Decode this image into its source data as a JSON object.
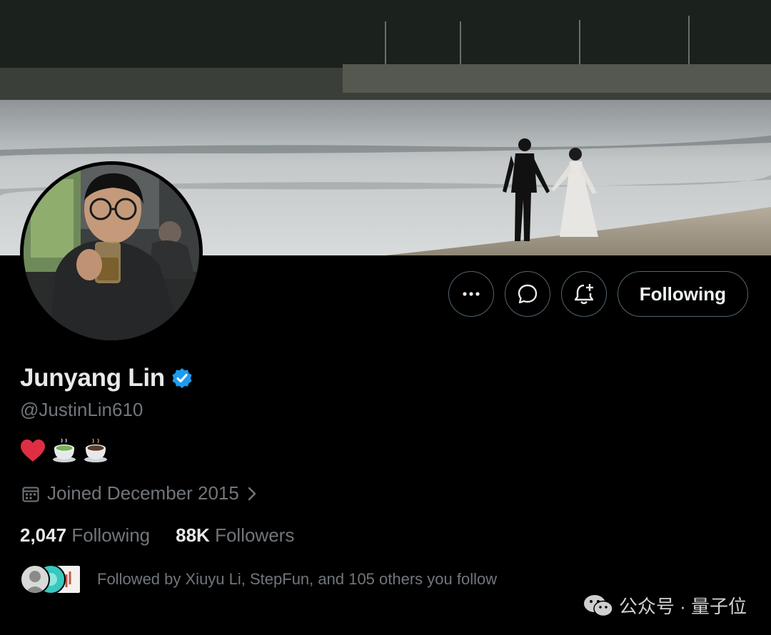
{
  "profile": {
    "display_name": "Junyang Lin",
    "handle": "@JustinLin610",
    "verified": true,
    "verified_color": "#1d9bf0",
    "bio_emojis": [
      "red-heart",
      "matcha-tea-cup",
      "coffee-cup"
    ],
    "joined": "Joined December 2015",
    "following_count": "2,047",
    "following_label": "Following",
    "followers_count": "88K",
    "followers_label": "Followers",
    "followed_by": "Followed by Xiuyu Li, StepFun, and 105 others you follow"
  },
  "actions": {
    "more_icon": "more-horizontal-icon",
    "message_icon": "message-bubble-icon",
    "notify_icon": "bell-plus-icon",
    "follow_label": "Following"
  },
  "watermark": {
    "text": "公众号 · 量子位",
    "icon": "wechat-icon"
  },
  "colors": {
    "background": "#000000",
    "text_primary": "#e7e9ea",
    "text_secondary": "#71767b",
    "button_border": "#536471"
  }
}
